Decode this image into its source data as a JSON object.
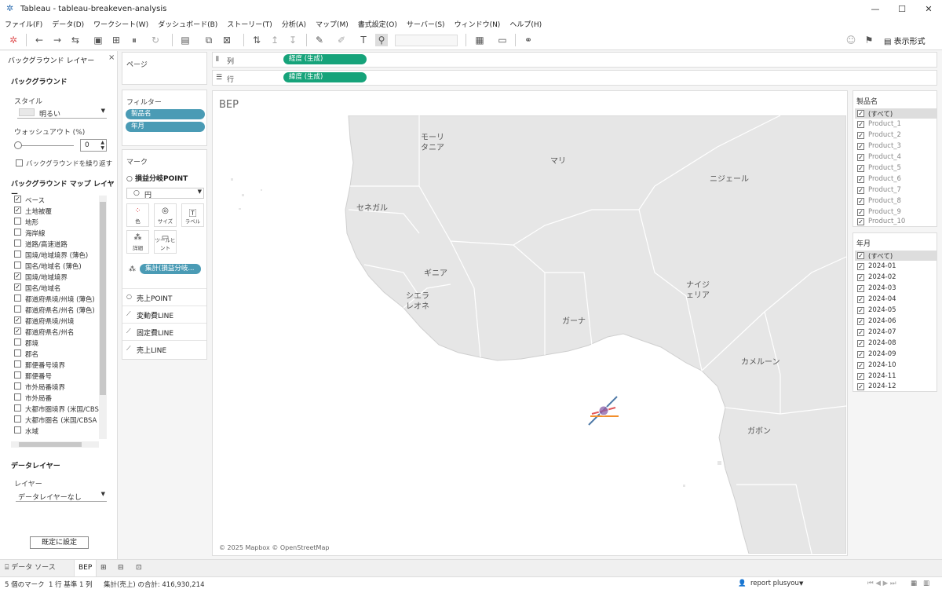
{
  "window": {
    "title": "Tableau - tableau-breakeven-analysis",
    "min": "—",
    "max": "☐",
    "close": "✕"
  },
  "menu": [
    "ファイル(F)",
    "データ(D)",
    "ワークシート(W)",
    "ダッシュボード(B)",
    "ストーリー(T)",
    "分析(A)",
    "マップ(M)",
    "書式設定(O)",
    "サーバー(S)",
    "ウィンドウ(N)",
    "ヘルプ(H)"
  ],
  "toolbar": {
    "show_me_label": "表示形式"
  },
  "bg_panel": {
    "header": "バックグラウンド レイヤー",
    "close": "×",
    "section_bg": "バックグラウンド",
    "style_label": "スタイル",
    "style_value": "明るい",
    "washout_label": "ウォッシュアウト (%)",
    "washout_value": "0",
    "repeat_label": "バックグラウンドを繰り返す",
    "map_layers_title": "バックグラウンド マップ レイヤー",
    "layers": [
      {
        "label": "ベース",
        "checked": true
      },
      {
        "label": "土地被覆",
        "checked": true
      },
      {
        "label": "地形",
        "checked": false
      },
      {
        "label": "海岸線",
        "checked": false
      },
      {
        "label": "道路/高速道路",
        "checked": false
      },
      {
        "label": "国境/地域境界 (薄色)",
        "checked": false
      },
      {
        "label": "国名/地域名 (薄色)",
        "checked": false
      },
      {
        "label": "国境/地域境界",
        "checked": true
      },
      {
        "label": "国名/地域名",
        "checked": true
      },
      {
        "label": "都道府県境/州境 (薄色)",
        "checked": false
      },
      {
        "label": "都道府県名/州名 (薄色)",
        "checked": false
      },
      {
        "label": "都道府県境/州境",
        "checked": true
      },
      {
        "label": "都道府県名/州名",
        "checked": true
      },
      {
        "label": "郡境",
        "checked": false
      },
      {
        "label": "郡名",
        "checked": false
      },
      {
        "label": "郵便番号境界",
        "checked": false
      },
      {
        "label": "郵便番号",
        "checked": false
      },
      {
        "label": "市外局番境界",
        "checked": false
      },
      {
        "label": "市外局番",
        "checked": false
      },
      {
        "label": "大都市圏境界 (米国/CBSA",
        "checked": false
      },
      {
        "label": "大都市圏名 (米国/CBSA",
        "checked": false
      },
      {
        "label": "水域",
        "checked": false
      }
    ],
    "data_layer_title": "データレイヤー",
    "layer_label": "レイヤー",
    "layer_value": "データレイヤーなし",
    "default_button": "既定に設定"
  },
  "pages_label": "ページ",
  "filters": {
    "title": "フィルター",
    "pills": [
      "製品名",
      "年月"
    ]
  },
  "marks": {
    "title": "マーク",
    "layer_name": "損益分岐POINT",
    "type_value": "円",
    "buttons": [
      "色",
      "サイズ",
      "ラベル",
      "詳細",
      "ツールヒント"
    ],
    "detail_pill": "集計(損益分岐...",
    "layers": [
      "売上POINT",
      "変動費LINE",
      "固定費LINE",
      "売上LINE"
    ]
  },
  "shelves": {
    "columns_label": "列",
    "columns_pill": "経度 (生成)",
    "rows_label": "行",
    "rows_pill": "緯度 (生成)"
  },
  "viz": {
    "title": "BEP",
    "map_labels": [
      "モーリ\nタニア",
      "マリ",
      "ニジェール",
      "セネガル",
      "ギニア",
      "シエラ\nレオネ",
      "ナイジ\nェリア",
      "ガーナ",
      "カメルーン",
      "ガボン"
    ],
    "attribution": "© 2025 Mapbox © OpenStreetMap",
    "mark_colors": {
      "point": "#8a5fa8",
      "line_a": "#4e79a7",
      "line_b": "#f28e2b",
      "line_c": "#e15759"
    }
  },
  "product_filter": {
    "title": "製品名",
    "items": [
      "(すべて)",
      "Product_1",
      "Product_2",
      "Product_3",
      "Product_4",
      "Product_5",
      "Product_6",
      "Product_7",
      "Product_8",
      "Product_9",
      "Product_10"
    ]
  },
  "month_filter": {
    "title": "年月",
    "items": [
      "(すべて)",
      "2024-01",
      "2024-02",
      "2024-03",
      "2024-04",
      "2024-05",
      "2024-06",
      "2024-07",
      "2024-08",
      "2024-09",
      "2024-10",
      "2024-11",
      "2024-12"
    ]
  },
  "tabs": {
    "datasource": "データ ソース",
    "sheet": "BEP"
  },
  "status": {
    "marks": "5 個のマーク",
    "rows": "1 行 基準 1 列",
    "sum": "集計(売上) の合計: 416,930,214",
    "user": "report plusyou"
  }
}
